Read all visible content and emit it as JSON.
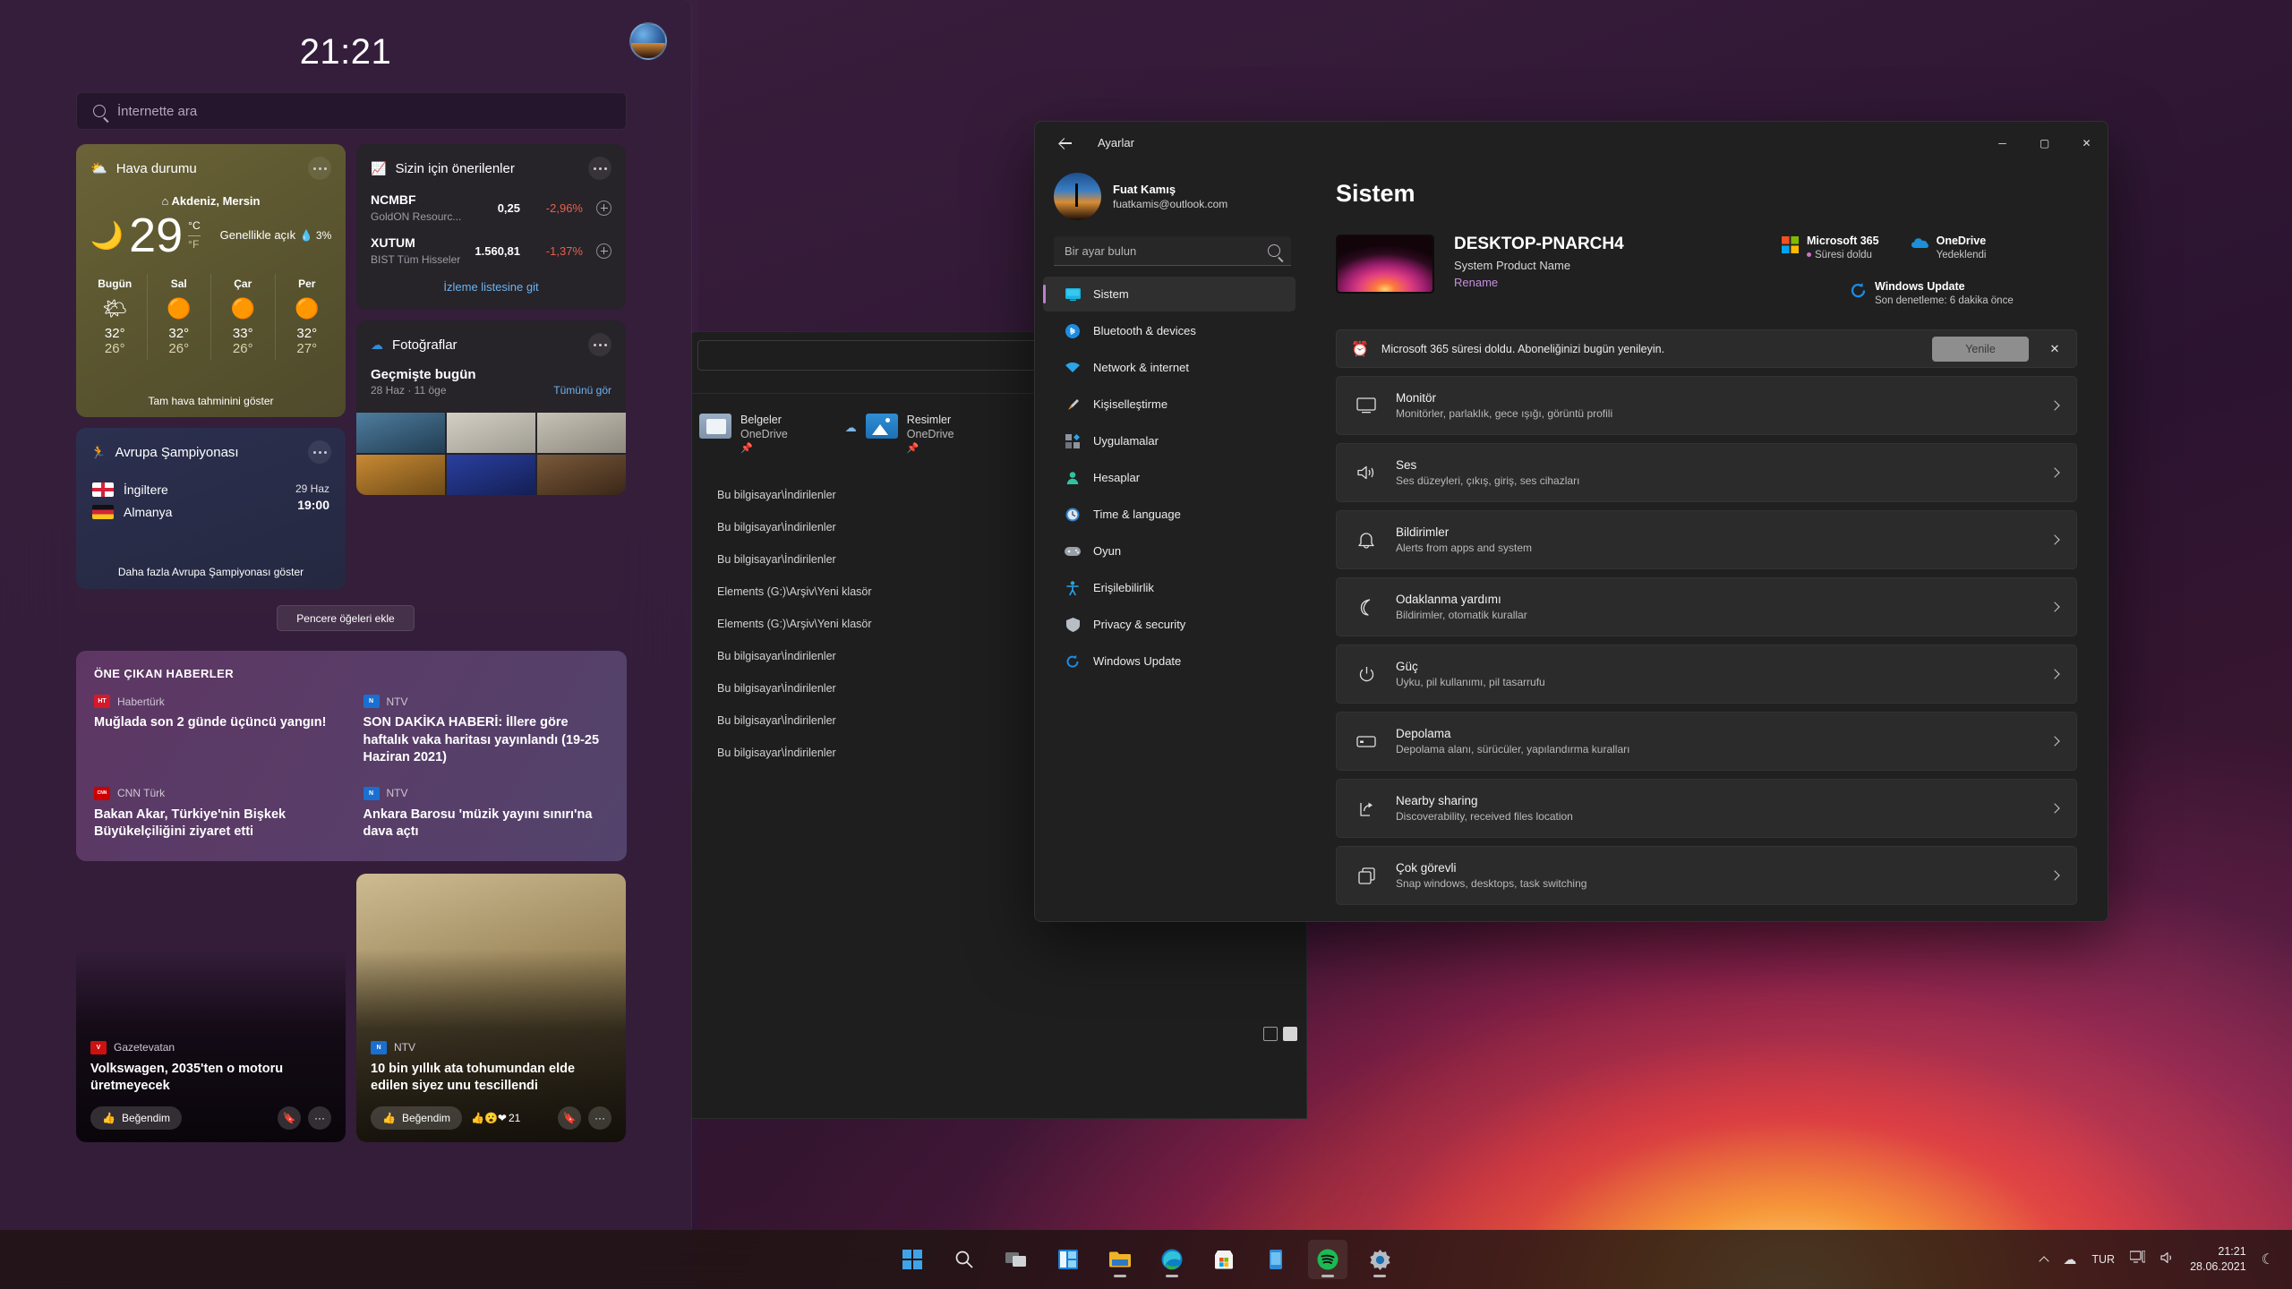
{
  "widgets": {
    "clock": "21:21",
    "avatar_name": "user-avatar",
    "search_placeholder": "İnternette ara",
    "add_widgets_label": "Pencere öğeleri ekle",
    "weather": {
      "title": "Hava durumu",
      "icon": "partly-cloudy-icon",
      "location": "Akdeniz, Mersin",
      "temp": "29",
      "unit_c": "°C",
      "unit_f": "°F",
      "condition": "Genellikle açık",
      "precip": "3%",
      "main_icon": "moon-cloud-icon",
      "footer": "Tam hava tahminini göster",
      "days": [
        {
          "day": "Bugün",
          "icon": "☀",
          "high": "32°",
          "low": "26°"
        },
        {
          "day": "Sal",
          "icon": "☀",
          "high": "32°",
          "low": "26°"
        },
        {
          "day": "Çar",
          "icon": "☀",
          "high": "33°",
          "low": "26°"
        },
        {
          "day": "Per",
          "icon": "☀",
          "high": "32°",
          "low": "27°"
        }
      ]
    },
    "stocks": {
      "title": "Sizin için önerilenler",
      "link": "İzleme listesine git",
      "rows": [
        {
          "symbol": "NCMBF",
          "company": "GoldON Resourc...",
          "price": "0,25",
          "change": "-2,96%"
        },
        {
          "symbol": "XUTUM",
          "company": "BIST Tüm Hisseler",
          "price": "1.560,81",
          "change": "-1,37%"
        }
      ],
      "change_color": "#e8604a"
    },
    "photos": {
      "title": "Fotoğraflar",
      "subtitle": "Geçmişte bugün",
      "meta": "28 Haz · 11 öge",
      "see_all": "Tümünü gör"
    },
    "sports": {
      "title": "Avrupa Şampiyonası",
      "team_home": "İngiltere",
      "team_away": "Almanya",
      "date": "29 Haz",
      "time": "19:00",
      "footer": "Daha fazla Avrupa Şampiyonası göster"
    },
    "news": {
      "section_title": "ÖNE ÇIKAN HABERLER",
      "items": [
        {
          "source": "Habertürk",
          "logo": "HT",
          "logo_bg": "#d6182b",
          "headline": "Muğlada son 2 günde üçüncü yangın!"
        },
        {
          "source": "NTV",
          "logo": "N",
          "logo_bg": "#1b6fd0",
          "headline": "SON DAKİKA HABERİ: İllere göre haftalık vaka haritası yayınlandı (19-25 Haziran 2021)"
        },
        {
          "source": "CNN Türk",
          "logo": "CNN",
          "logo_bg": "#cc0000",
          "headline": "Bakan Akar, Türkiye'nin Bişkek Büyükelçiliğini ziyaret etti"
        },
        {
          "source": "NTV",
          "logo": "N",
          "logo_bg": "#1b6fd0",
          "headline": "Ankara Barosu 'müzik yayını sınırı'na dava açtı"
        }
      ],
      "cards": [
        {
          "source": "Gazetevatan",
          "logo": "V",
          "logo_bg": "#cc1111",
          "headline": "Volkswagen, 2035'ten o motoru üretmeyecek",
          "like_label": "Beğendim",
          "reactions": "",
          "reaction_count": ""
        },
        {
          "source": "NTV",
          "logo": "N",
          "logo_bg": "#1b6fd0",
          "headline": "10 bin yıllık ata tohumundan elde edilen siyez unu tescillendi",
          "like_label": "Beğendim",
          "reactions": "👍😮❤",
          "reaction_count": "21"
        }
      ]
    }
  },
  "explorer": {
    "address_value": "",
    "search_placeholder": "",
    "quick_access": [
      {
        "name": "Belgeler",
        "sub": "OneDrive",
        "icon": "documents-folder-icon"
      },
      {
        "name": "Resimler",
        "sub": "OneDrive",
        "icon": "pictures-folder-icon"
      }
    ],
    "recent_paths": [
      "Bu bilgisayar\\İndirilenler",
      "Bu bilgisayar\\İndirilenler",
      "Bu bilgisayar\\İndirilenler",
      "Elements (G:)\\Arşiv\\Yeni klasör",
      "Elements (G:)\\Arşiv\\Yeni klasör",
      "Bu bilgisayar\\İndirilenler",
      "Bu bilgisayar\\İndirilenler",
      "Bu bilgisayar\\İndirilenler",
      "Bu bilgisayar\\İndirilenler"
    ]
  },
  "settings": {
    "title": "Ayarlar",
    "minimize": "─",
    "maximize": "▢",
    "close": "✕",
    "account": {
      "name": "Fuat Kamış",
      "email": "fuatkamis@outlook.com"
    },
    "search_placeholder": "Bir ayar bulun",
    "nav": [
      {
        "label": "Sistem",
        "icon": "monitor-icon",
        "active": true
      },
      {
        "label": "Bluetooth & devices",
        "icon": "bluetooth-icon",
        "active": false
      },
      {
        "label": "Network & internet",
        "icon": "wifi-icon",
        "active": false
      },
      {
        "label": "Kişiselleştirme",
        "icon": "paintbrush-icon",
        "active": false
      },
      {
        "label": "Uygulamalar",
        "icon": "apps-icon",
        "active": false
      },
      {
        "label": "Hesaplar",
        "icon": "person-icon",
        "active": false
      },
      {
        "label": "Time & language",
        "icon": "clock-icon",
        "active": false
      },
      {
        "label": "Oyun",
        "icon": "gamepad-icon",
        "active": false
      },
      {
        "label": "Erişilebilirlik",
        "icon": "accessibility-icon",
        "active": false
      },
      {
        "label": "Privacy & security",
        "icon": "shield-icon",
        "active": false
      },
      {
        "label": "Windows Update",
        "icon": "update-icon",
        "active": false
      }
    ],
    "page_heading": "Sistem",
    "device": {
      "name": "DESKTOP-PNARCH4",
      "product": "System Product Name",
      "rename": "Rename"
    },
    "status": [
      {
        "title": "Microsoft 365",
        "sub": "Süresi doldu",
        "icon": "microsoft-logo-icon",
        "dot": true
      },
      {
        "title": "OneDrive",
        "sub": "Yedeklendi",
        "icon": "onedrive-icon",
        "dot": false
      },
      {
        "title": "Windows Update",
        "sub": "Son denetleme: 6 dakika önce",
        "icon": "update-icon",
        "dot": false
      }
    ],
    "banner": {
      "text": "Microsoft 365 süresi doldu. Aboneliğinizi bugün yenileyin.",
      "button": "Yenile",
      "icon": "clock-alert-icon"
    },
    "rows": [
      {
        "title": "Monitör",
        "sub": "Monitörler, parlaklık, gece ışığı, görüntü profili",
        "icon": "⬓"
      },
      {
        "title": "Ses",
        "sub": "Ses düzeyleri, çıkış, giriş, ses cihazları",
        "icon": "🔊"
      },
      {
        "title": "Bildirimler",
        "sub": "Alerts from apps and system",
        "icon": "🔔"
      },
      {
        "title": "Odaklanma yardımı",
        "sub": "Bildirimler, otomatik kurallar",
        "icon": "☾"
      },
      {
        "title": "Güç",
        "sub": "Uyku, pil kullanımı, pil tasarrufu",
        "icon": "⏻"
      },
      {
        "title": "Depolama",
        "sub": "Depolama alanı, sürücüler, yapılandırma kuralları",
        "icon": "▭"
      },
      {
        "title": "Nearby sharing",
        "sub": "Discoverability, received files location",
        "icon": "⇱"
      },
      {
        "title": "Çok görevli",
        "sub": "Snap windows, desktops, task switching",
        "icon": "❐"
      }
    ]
  },
  "taskbar": {
    "items": [
      {
        "name": "start-button",
        "running": false,
        "active": false
      },
      {
        "name": "search-icon",
        "running": false,
        "active": false
      },
      {
        "name": "task-view-icon",
        "running": false,
        "active": false
      },
      {
        "name": "widgets-icon",
        "running": false,
        "active": false
      },
      {
        "name": "file-explorer-icon",
        "running": true,
        "active": false
      },
      {
        "name": "edge-icon",
        "running": true,
        "active": false
      },
      {
        "name": "microsoft-store-icon",
        "running": false,
        "active": false
      },
      {
        "name": "phone-link-icon",
        "running": false,
        "active": false
      },
      {
        "name": "spotify-icon",
        "running": true,
        "active": true
      },
      {
        "name": "settings-icon",
        "running": true,
        "active": false
      }
    ],
    "language": "TUR",
    "time": "21:21",
    "date": "28.06.2021"
  }
}
